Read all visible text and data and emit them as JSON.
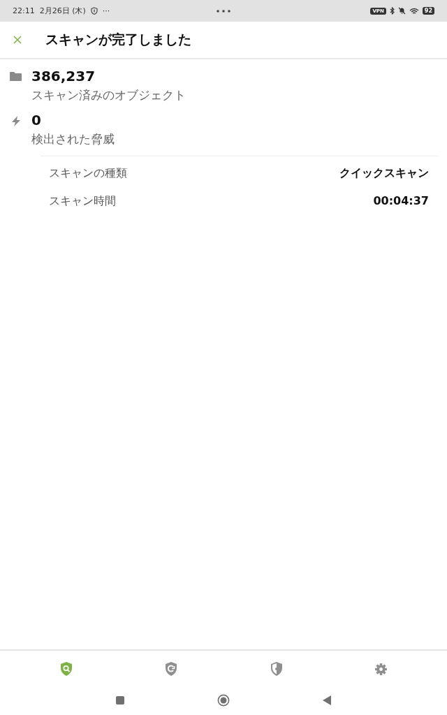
{
  "status_bar": {
    "time": "22:11",
    "date": "2月26日 (木)",
    "more": "···",
    "vpn": "VPN",
    "battery": "92"
  },
  "app_bar": {
    "title": "スキャンが完了しました"
  },
  "stats": [
    {
      "kind": "folder",
      "value": "386,237",
      "label": "スキャン済みのオブジェクト"
    },
    {
      "kind": "threat",
      "value": "0",
      "label": "検出された脅威"
    }
  ],
  "details": [
    {
      "label": "スキャンの種類",
      "value": "クイックスキャン"
    },
    {
      "label": "スキャン時間",
      "value": "00:04:37"
    }
  ],
  "bottom_nav": [
    {
      "kind": "scan",
      "selected": true
    },
    {
      "kind": "update",
      "selected": false
    },
    {
      "kind": "protection",
      "selected": false
    },
    {
      "kind": "settings",
      "selected": false
    }
  ]
}
